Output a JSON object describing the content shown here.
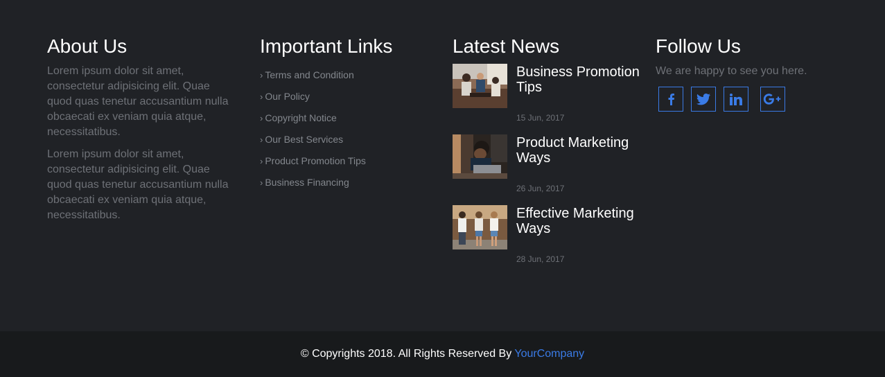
{
  "about": {
    "title": "About Us",
    "paragraphs": [
      "Lorem ipsum dolor sit amet, consectetur adipisicing elit. Quae quod quas tenetur accusantium nulla obcaecati ex veniam quia atque, necessitatibus.",
      "Lorem ipsum dolor sit amet, consectetur adipisicing elit. Quae quod quas tenetur accusantium nulla obcaecati ex veniam quia atque, necessitatibus."
    ]
  },
  "links": {
    "title": "Important Links",
    "items": [
      "Terms and Condition",
      "Our Policy",
      "Copyright Notice",
      "Our Best Services",
      "Product Promotion Tips",
      "Business Financing"
    ]
  },
  "news": {
    "title": "Latest News",
    "items": [
      {
        "title": "Business Promotion Tips",
        "date": "15 Jun, 2017",
        "image": "office-meeting-photo"
      },
      {
        "title": "Product Marketing Ways",
        "date": "26 Jun, 2017",
        "image": "stressed-man-laptop-photo"
      },
      {
        "title": "Effective Marketing Ways",
        "date": "28 Jun, 2017",
        "image": "friends-walking-photo"
      }
    ]
  },
  "follow": {
    "title": "Follow Us",
    "text": "We are happy to see you here.",
    "icons": [
      "facebook-icon",
      "twitter-icon",
      "linkedin-icon",
      "google-plus-icon"
    ]
  },
  "bottom": {
    "copyright": "© Copyrights 2018. All Rights Reserved By",
    "company": "YourCompany"
  },
  "colors": {
    "background": "#202226",
    "bottom_bar": "#181a1c",
    "accent": "#3a7be6",
    "muted_text": "#6e7177"
  }
}
